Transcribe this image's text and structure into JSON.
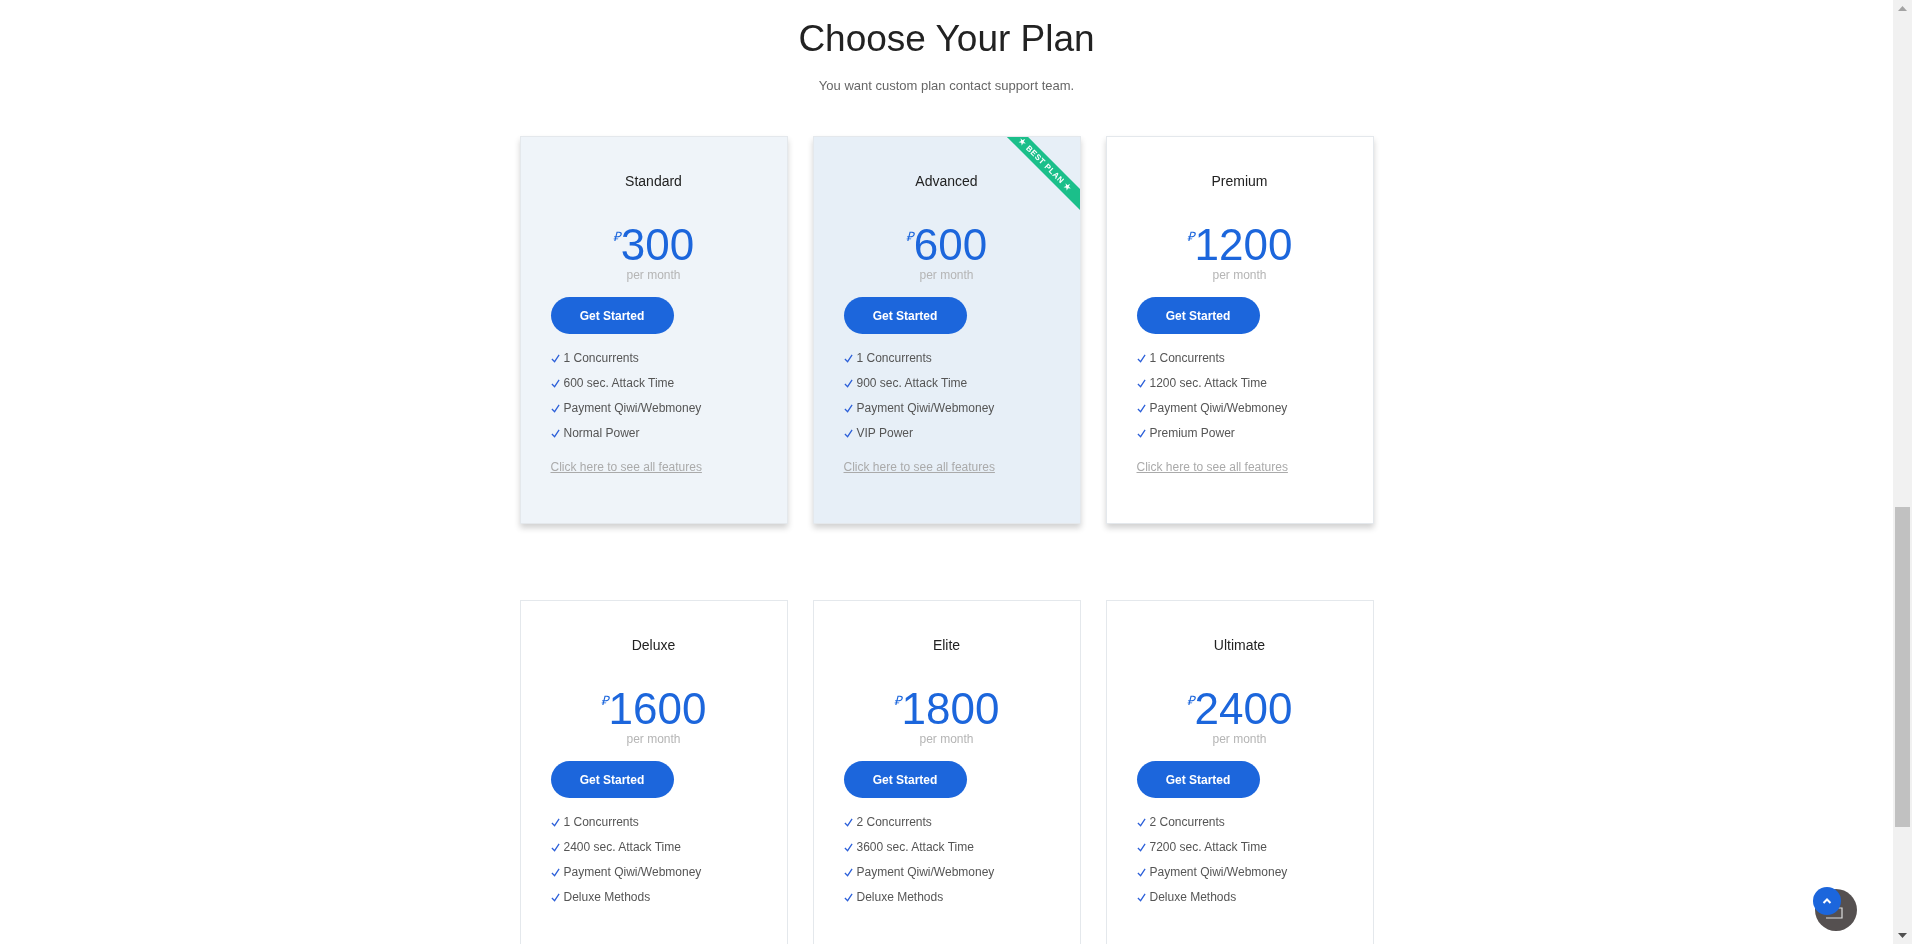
{
  "header": {
    "title": "Choose Your Plan",
    "subtitle": "You want custom plan contact support team."
  },
  "plans": [
    {
      "kind": "tinted",
      "name": "Standard",
      "currency": "₽",
      "price": "300",
      "period": "per month",
      "button": "Get Started",
      "features": [
        "1 Concurrents",
        "600 sec. Attack Time",
        "Payment Qiwi/Webmoney",
        "Normal Power"
      ],
      "link": "Click here to see all features"
    },
    {
      "kind": "featured",
      "ribbon": "★ BEST PLAN ★",
      "name": "Advanced",
      "currency": "₽",
      "price": "600",
      "period": "per month",
      "button": "Get Started",
      "features": [
        "1 Concurrents",
        "900 sec. Attack Time",
        "Payment Qiwi/Webmoney",
        "VIP Power"
      ],
      "link": "Click here to see all features"
    },
    {
      "kind": "raised",
      "name": "Premium",
      "currency": "₽",
      "price": "1200",
      "period": "per month",
      "button": "Get Started",
      "features": [
        "1 Concurrents",
        "1200 sec. Attack Time",
        "Payment Qiwi/Webmoney",
        "Premium Power"
      ],
      "link": "Click here to see all features"
    },
    {
      "kind": "flat",
      "name": "Deluxe",
      "currency": "₽",
      "price": "1600",
      "period": "per month",
      "button": "Get Started",
      "features": [
        "1 Concurrents",
        "2400 sec. Attack Time",
        "Payment Qiwi/Webmoney",
        "Deluxe Methods"
      ]
    },
    {
      "kind": "flat",
      "name": "Elite",
      "currency": "₽",
      "price": "1800",
      "period": "per month",
      "button": "Get Started",
      "features": [
        "2 Concurrents",
        "3600 sec. Attack Time",
        "Payment Qiwi/Webmoney",
        "Deluxe Methods"
      ]
    },
    {
      "kind": "flat",
      "name": "Ultimate",
      "currency": "₽",
      "price": "2400",
      "period": "per month",
      "button": "Get Started",
      "features": [
        "2 Concurrents",
        "7200 sec. Attack Time",
        "Payment Qiwi/Webmoney",
        "Deluxe Methods"
      ]
    }
  ]
}
